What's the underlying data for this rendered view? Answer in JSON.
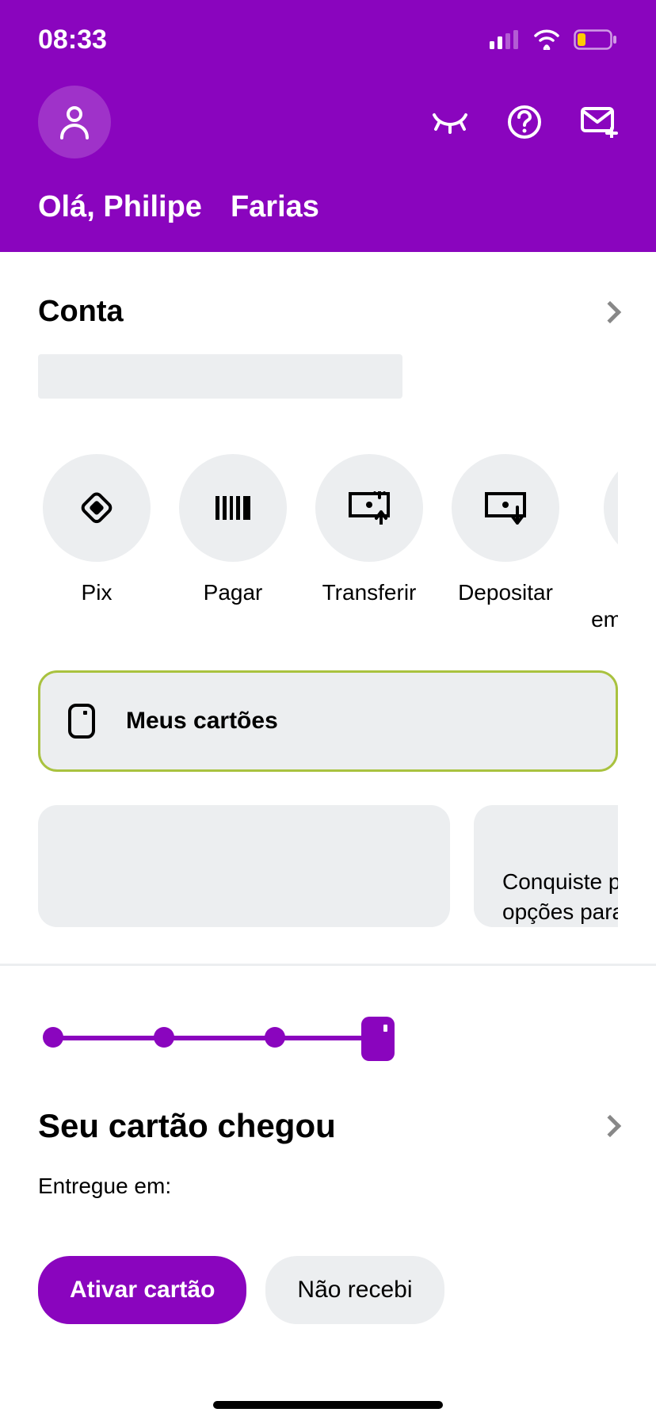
{
  "status": {
    "time": "08:33"
  },
  "greeting": {
    "hello": "Olá, Philipe",
    "surname": "Farias"
  },
  "account": {
    "title": "Conta"
  },
  "actions": [
    {
      "label": "Pix",
      "icon": "pix-icon"
    },
    {
      "label": "Pagar",
      "icon": "barcode-icon"
    },
    {
      "label": "Transferir",
      "icon": "transfer-out-icon"
    },
    {
      "label": "Depositar",
      "icon": "transfer-in-icon"
    },
    {
      "label": "Pegar emprestado",
      "icon": "loan-icon"
    }
  ],
  "cards_button": {
    "label": "Meus cartões"
  },
  "promos": [
    {
      "text": ""
    },
    {
      "text": "Conquiste p\nopções para"
    }
  ],
  "card_tracking": {
    "title": "Seu cartão chegou",
    "delivered_label": "Entregue em:",
    "activate": "Ativar cartão",
    "not_received": "Não recebi"
  }
}
